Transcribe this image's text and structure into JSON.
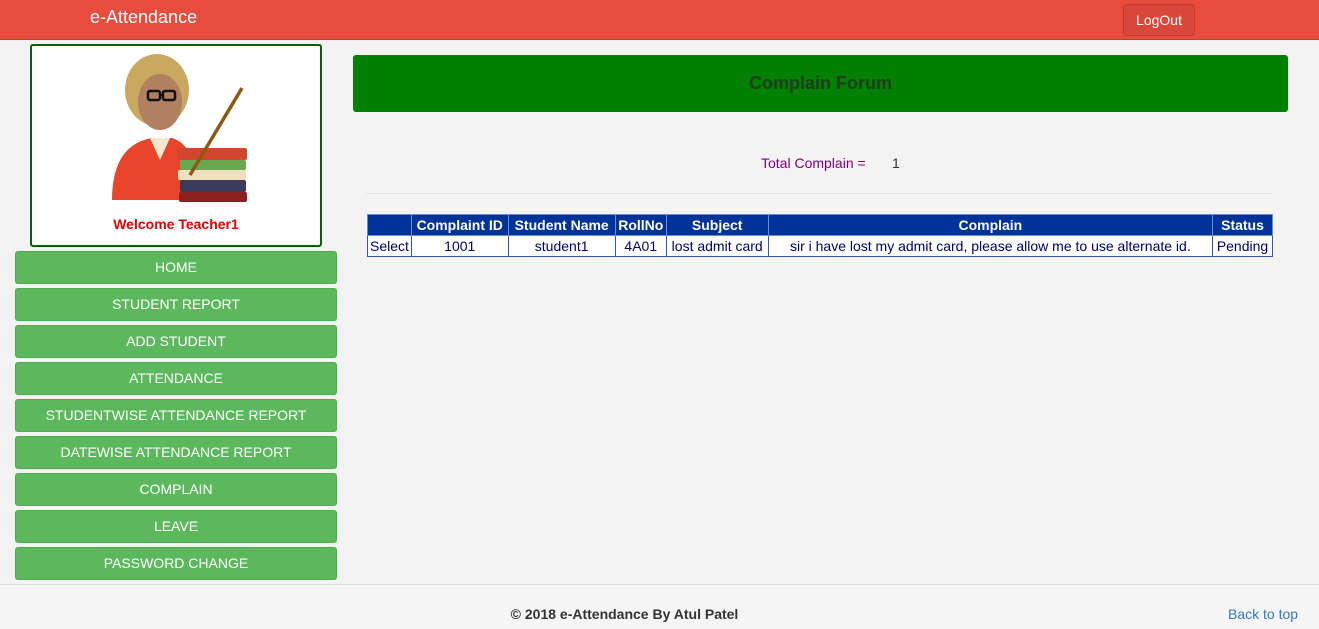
{
  "header": {
    "brand": "e-Attendance",
    "logout_label": "LogOut"
  },
  "profile": {
    "welcome": "Welcome Teacher1",
    "avatar_icon": "teacher-avatar-icon"
  },
  "menu": [
    {
      "label": "HOME"
    },
    {
      "label": "STUDENT REPORT"
    },
    {
      "label": "ADD STUDENT"
    },
    {
      "label": "ATTENDANCE"
    },
    {
      "label": "STUDENTWISE ATTENDANCE REPORT"
    },
    {
      "label": "DATEWISE ATTENDANCE REPORT"
    },
    {
      "label": "COMPLAIN"
    },
    {
      "label": "LEAVE"
    },
    {
      "label": "PASSWORD CHANGE"
    }
  ],
  "main": {
    "title": "Complain Forum",
    "total_label": "Total Complain =",
    "total_value": "1"
  },
  "table": {
    "columns": [
      "",
      "Complaint ID",
      "Student Name",
      "RollNo",
      "Subject",
      "Complain",
      "Status"
    ],
    "rows": [
      {
        "select": "Select",
        "id": "1001",
        "student": "student1",
        "roll": "4A01",
        "subject": "lost admit card",
        "complain": "sir i have lost my admit card, please allow me to use alternate id.",
        "status": "Pending"
      }
    ]
  },
  "footer": {
    "copyright": "© 2018 e-Attendance By Atul Patel",
    "back_to_top": "Back to top"
  },
  "colors": {
    "topbar": "#e84c3d",
    "menu": "#5cb85c",
    "forum_header": "#008000",
    "table_header": "#003399"
  }
}
